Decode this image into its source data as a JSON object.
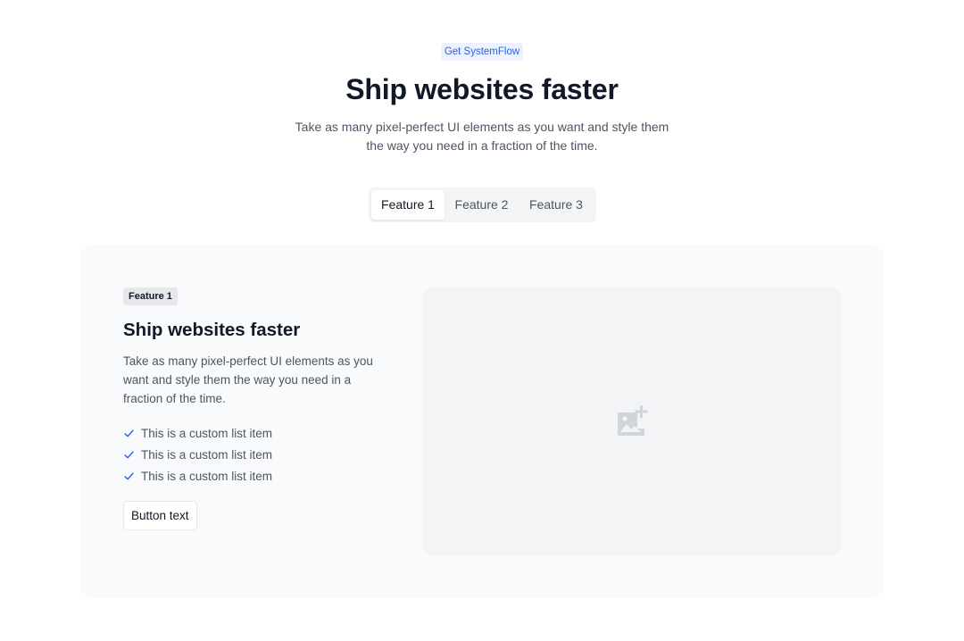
{
  "hero": {
    "eyebrow": "Get SystemFlow",
    "title": "Ship websites faster",
    "subtitle": "Take as many pixel-perfect UI elements as you want and style them the way you need in a fraction of the time."
  },
  "tabs": [
    {
      "label": "Feature 1",
      "active": true
    },
    {
      "label": "Feature 2",
      "active": false
    },
    {
      "label": "Feature 3",
      "active": false
    }
  ],
  "panel": {
    "badge": "Feature 1",
    "title": "Ship websites faster",
    "description": "Take as many pixel-perfect UI elements as you want and style them the way you need in a fraction of the time.",
    "list_items": [
      "This is a custom list item",
      "This is a custom list item",
      "This is a custom list item"
    ],
    "button_label": "Button text",
    "image_icon": "add-photo-icon"
  },
  "colors": {
    "accent": "#2563eb",
    "panel_bg": "#f9fafb",
    "image_bg": "#f3f4f6",
    "icon": "#d1d5db"
  }
}
